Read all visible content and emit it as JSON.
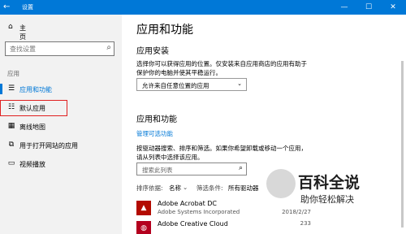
{
  "window": {
    "title": "设置",
    "back_icon": "back-arrow-icon",
    "minimize": "—",
    "maximize": "☐",
    "close": "✕"
  },
  "sidebar": {
    "home_label": "主页",
    "search_placeholder": "查找设置",
    "section_label": "应用",
    "items": [
      {
        "label": "应用和功能",
        "icon": "apps-list-icon",
        "active": true
      },
      {
        "label": "默认应用",
        "icon": "default-apps-icon",
        "active": false,
        "highlighted": true
      },
      {
        "label": "离线地图",
        "icon": "map-icon",
        "active": false
      },
      {
        "label": "用于打开网站的应用",
        "icon": "web-apps-icon",
        "active": false
      },
      {
        "label": "视频播放",
        "icon": "video-icon",
        "active": false
      }
    ]
  },
  "main": {
    "title": "应用和功能",
    "install_heading": "应用安装",
    "install_desc": "选择你可以获得应用的位置。仅安装来自应用商店的应用有助于保护你的电脑并使其平稳运行。",
    "install_select": "允许来自任意位置的应用",
    "apps_heading": "应用和功能",
    "manage_link": "管理可选功能",
    "apps_desc": "按驱动器搜索、排序和筛选。如果你希望卸载或移动一个应用，请从列表中选择该应用。",
    "list_search_placeholder": "搜索此列表",
    "sort_label": "排序依据:",
    "sort_value": "名称",
    "filter_label": "筛选条件:",
    "filter_value": "所有驱动器",
    "apps": [
      {
        "name": "Adobe Acrobat DC",
        "publisher": "Adobe Systems Incorporated",
        "date": "2018/2/27",
        "size": ""
      },
      {
        "name": "Adobe Creative Cloud",
        "publisher": "",
        "date": "",
        "size": "233"
      }
    ]
  },
  "watermark": {
    "title": "百科全说",
    "subtitle": "助你轻松解决"
  },
  "colors": {
    "accent": "#0078d7",
    "highlight": "#e02020"
  }
}
